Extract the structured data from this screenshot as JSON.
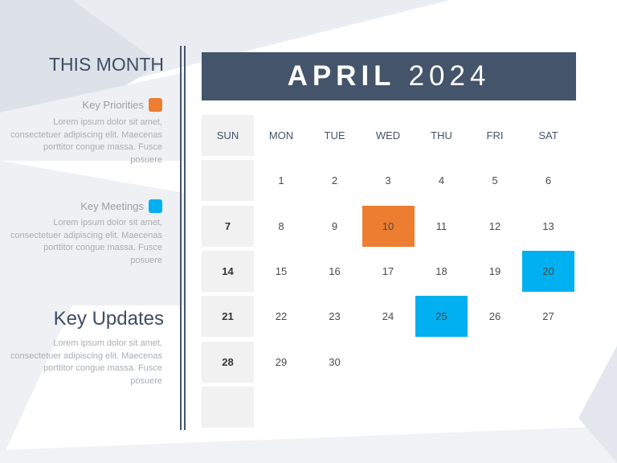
{
  "sidebar": {
    "title": "THIS MONTH",
    "sections": [
      {
        "label": "Key Priorities",
        "color": "#ed7d31",
        "text": "Lorem ipsum dolor sit amet, consectetuer adipiscing elit. Maecenas porttitor congue massa. Fusce posuere"
      },
      {
        "label": "Key Meetings",
        "color": "#00b0f0",
        "text": "Lorem ipsum dolor sit amet, consectetuer adipiscing elit. Maecenas porttitor congue massa. Fusce posuere"
      }
    ],
    "updates": {
      "title": "Key Updates",
      "text": "Lorem ipsum dolor sit amet, consectetuer adipiscing elit. Maecenas porttitor congue massa. Fusce posuere"
    }
  },
  "calendar": {
    "month": "APRIL",
    "year": "2024",
    "weekdays": [
      "SUN",
      "MON",
      "TUE",
      "WED",
      "THU",
      "FRI",
      "SAT"
    ],
    "weeks": [
      [
        "",
        "1",
        "2",
        "3",
        "4",
        "5",
        "6"
      ],
      [
        "7",
        "8",
        "9",
        "10",
        "11",
        "12",
        "13"
      ],
      [
        "14",
        "15",
        "16",
        "17",
        "18",
        "19",
        "20"
      ],
      [
        "21",
        "22",
        "23",
        "24",
        "25",
        "26",
        "27"
      ],
      [
        "28",
        "29",
        "30",
        "",
        "",
        "",
        ""
      ],
      [
        "",
        "",
        "",
        "",
        "",
        "",
        ""
      ]
    ],
    "highlights": [
      {
        "day": "10",
        "type": "priority",
        "color": "#ed7d31"
      },
      {
        "day": "20",
        "type": "meeting",
        "color": "#00b0f0"
      },
      {
        "day": "25",
        "type": "meeting",
        "color": "#00b0f0"
      }
    ]
  },
  "colors": {
    "accent_dark": "#44546a",
    "priority": "#ed7d31",
    "meeting": "#00b0f0"
  }
}
